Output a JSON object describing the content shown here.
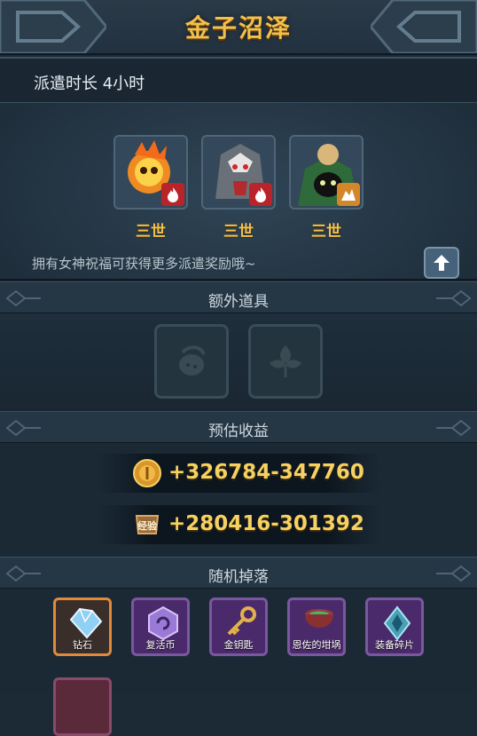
{
  "header": {
    "title": "金子沼泽"
  },
  "dispatch": {
    "duration_text": "派遣时长 4小时",
    "heroes": [
      {
        "label": "三世",
        "element_icon": "fire-icon"
      },
      {
        "label": "三世",
        "element_icon": "fire-icon"
      },
      {
        "label": "三世",
        "element_icon": "earth-icon"
      }
    ],
    "hint": "拥有女神祝福可获得更多派遣奖励哦~"
  },
  "sections": {
    "extra_items": "额外道具",
    "estimated_income": "预估收益",
    "random_drops": "随机掉落"
  },
  "extra_items": [
    {
      "icon": "fruit-icon"
    },
    {
      "icon": "leaf-icon"
    }
  ],
  "income": {
    "gold": {
      "icon": "gold-coin-icon",
      "value": "+326784-347760"
    },
    "exp": {
      "icon_label": "经验",
      "value": "+280416-301392"
    }
  },
  "drops": [
    {
      "name": "钻石",
      "icon": "diamond-icon"
    },
    {
      "name": "复活币",
      "icon": "revive-coin-icon"
    },
    {
      "name": "金钥匙",
      "icon": "gold-key-icon"
    },
    {
      "name": "恩佐的坩埚",
      "icon": "cauldron-icon"
    },
    {
      "name": "装备碎片",
      "icon": "equipment-shard-icon"
    }
  ],
  "colors": {
    "title": "#f4c04b",
    "income_text": "#f6d162",
    "fire_badge": "#b8242a",
    "earth_badge": "#d4862a",
    "drop_selected_border": "#e08a3a",
    "drop_border": "#7a58a0"
  }
}
